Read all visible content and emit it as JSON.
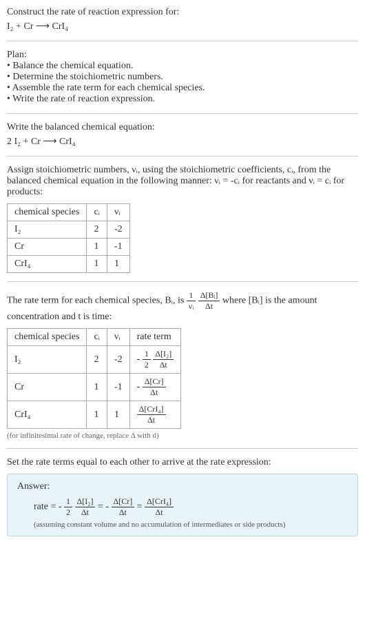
{
  "sec1": {
    "title": "Construct the rate of reaction expression for:",
    "eq": "I₂ + Cr ⟶ CrI₄"
  },
  "plan": {
    "title": "Plan:",
    "items": [
      "• Balance the chemical equation.",
      "• Determine the stoichiometric numbers.",
      "• Assemble the rate term for each chemical species.",
      "• Write the rate of reaction expression."
    ]
  },
  "balanced": {
    "title": "Write the balanced chemical equation:",
    "eq": "2 I₂ + Cr ⟶ CrI₄"
  },
  "stoich": {
    "intro": "Assign stoichiometric numbers, νᵢ, using the stoichiometric coefficients, cᵢ, from the balanced chemical equation in the following manner: νᵢ = -cᵢ for reactants and νᵢ = cᵢ for products:",
    "headers": [
      "chemical species",
      "cᵢ",
      "νᵢ"
    ],
    "rows": [
      [
        "I₂",
        "2",
        "-2"
      ],
      [
        "Cr",
        "1",
        "-1"
      ],
      [
        "CrI₄",
        "1",
        "1"
      ]
    ]
  },
  "rateterm": {
    "intro1": "The rate term for each chemical species, Bᵢ, is ",
    "intro2": " where [Bᵢ] is the amount concentration and t is time:",
    "headers": [
      "chemical species",
      "cᵢ",
      "νᵢ",
      "rate term"
    ],
    "rows": [
      {
        "species": "I₂",
        "c": "2",
        "v": "-2"
      },
      {
        "species": "Cr",
        "c": "1",
        "v": "-1"
      },
      {
        "species": "CrI₄",
        "c": "1",
        "v": "1"
      }
    ],
    "note": "(for infinitesimal rate of change, replace Δ with d)"
  },
  "final": {
    "intro": "Set the rate terms equal to each other to arrive at the rate expression:",
    "answer_label": "Answer:",
    "note": "(assuming constant volume and no accumulation of intermediates or side products)"
  }
}
